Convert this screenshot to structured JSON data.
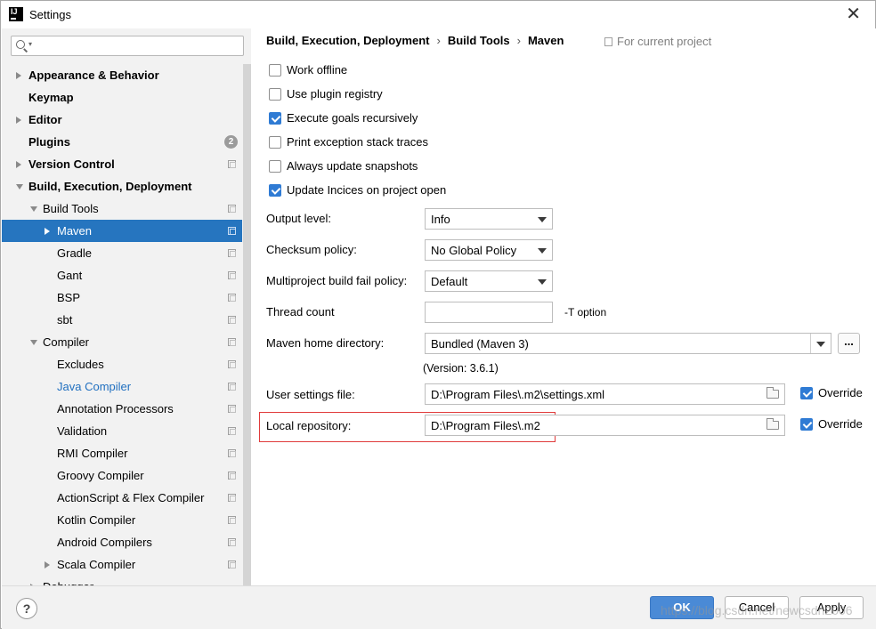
{
  "window": {
    "title": "Settings",
    "close": "✕"
  },
  "search": {
    "placeholder": ""
  },
  "tree": [
    {
      "label": "Appearance & Behavior",
      "bold": true,
      "indent": 0,
      "arrow": "right",
      "copy": false
    },
    {
      "label": "Keymap",
      "bold": true,
      "indent": 0,
      "arrow": "",
      "copy": false
    },
    {
      "label": "Editor",
      "bold": true,
      "indent": 0,
      "arrow": "right",
      "copy": false
    },
    {
      "label": "Plugins",
      "bold": true,
      "indent": 0,
      "arrow": "",
      "copy": false,
      "badge": "2"
    },
    {
      "label": "Version Control",
      "bold": true,
      "indent": 0,
      "arrow": "right",
      "copy": true
    },
    {
      "label": "Build, Execution, Deployment",
      "bold": true,
      "indent": 0,
      "arrow": "down",
      "copy": false
    },
    {
      "label": "Build Tools",
      "bold": false,
      "indent": 1,
      "arrow": "down",
      "copy": true
    },
    {
      "label": "Maven",
      "bold": false,
      "indent": 2,
      "arrow": "right",
      "copy": true,
      "selected": true
    },
    {
      "label": "Gradle",
      "bold": false,
      "indent": 2,
      "arrow": "",
      "copy": true
    },
    {
      "label": "Gant",
      "bold": false,
      "indent": 2,
      "arrow": "",
      "copy": true
    },
    {
      "label": "BSP",
      "bold": false,
      "indent": 2,
      "arrow": "",
      "copy": true
    },
    {
      "label": "sbt",
      "bold": false,
      "indent": 2,
      "arrow": "",
      "copy": true
    },
    {
      "label": "Compiler",
      "bold": false,
      "indent": 1,
      "arrow": "down",
      "copy": true
    },
    {
      "label": "Excludes",
      "bold": false,
      "indent": 2,
      "arrow": "",
      "copy": true
    },
    {
      "label": "Java Compiler",
      "bold": false,
      "indent": 2,
      "arrow": "",
      "copy": true,
      "link": true
    },
    {
      "label": "Annotation Processors",
      "bold": false,
      "indent": 2,
      "arrow": "",
      "copy": true
    },
    {
      "label": "Validation",
      "bold": false,
      "indent": 2,
      "arrow": "",
      "copy": true
    },
    {
      "label": "RMI Compiler",
      "bold": false,
      "indent": 2,
      "arrow": "",
      "copy": true
    },
    {
      "label": "Groovy Compiler",
      "bold": false,
      "indent": 2,
      "arrow": "",
      "copy": true
    },
    {
      "label": "ActionScript & Flex Compiler",
      "bold": false,
      "indent": 2,
      "arrow": "",
      "copy": true
    },
    {
      "label": "Kotlin Compiler",
      "bold": false,
      "indent": 2,
      "arrow": "",
      "copy": true
    },
    {
      "label": "Android Compilers",
      "bold": false,
      "indent": 2,
      "arrow": "",
      "copy": true
    },
    {
      "label": "Scala Compiler",
      "bold": false,
      "indent": 2,
      "arrow": "right",
      "copy": true
    },
    {
      "label": "Debugger",
      "bold": false,
      "indent": 1,
      "arrow": "right",
      "copy": false
    }
  ],
  "breadcrumb": {
    "part1": "Build, Execution, Deployment",
    "sep": "›",
    "part2": "Build Tools",
    "part3": "Maven"
  },
  "for_project": "For current project",
  "checkboxes": [
    {
      "label": "Work offline",
      "checked": false
    },
    {
      "label": "Use plugin registry",
      "checked": false
    },
    {
      "label": "Execute goals recursively",
      "checked": true
    },
    {
      "label": "Print exception stack traces",
      "checked": false
    },
    {
      "label": "Always update snapshots",
      "checked": false
    },
    {
      "label": "Update Incices on project open",
      "checked": true
    }
  ],
  "fields": {
    "output_level": {
      "label": "Output level:",
      "value": "Info"
    },
    "checksum_policy": {
      "label": "Checksum policy:",
      "value": "No Global Policy"
    },
    "fail_policy": {
      "label": "Multiproject build fail policy:",
      "value": "Default"
    },
    "thread_count": {
      "label": "Thread count",
      "value": "",
      "hint": "-T option"
    },
    "maven_home": {
      "label": "Maven home directory:",
      "value": "Bundled (Maven 3)",
      "browse": "..."
    },
    "version": "(Version: 3.6.1)",
    "user_settings": {
      "label": "User settings file:",
      "value": "D:\\Program Files\\.m2\\settings.xml",
      "override_label": "Override",
      "override": true
    },
    "local_repo": {
      "label": "Local repository:",
      "value": "D:\\Program Files\\.m2",
      "override_label": "Override",
      "override": true
    }
  },
  "footer": {
    "help": "?",
    "ok": "OK",
    "cancel": "Cancel",
    "apply": "Apply",
    "watermark": "https://blog.csdn.net/newcsdn2006"
  },
  "colors": {
    "selection": "#2675bf",
    "accent": "#2f7bd4",
    "highlight": "#e03b3b",
    "link": "#2170c0"
  }
}
